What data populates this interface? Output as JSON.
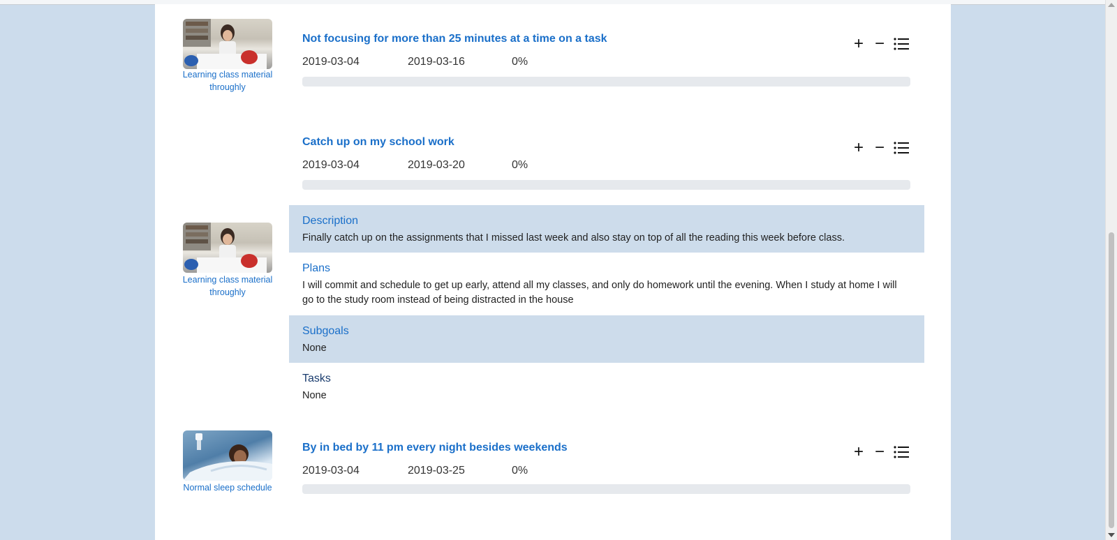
{
  "goals": [
    {
      "title": "Not focusing for more than 25 minutes at a time on a task",
      "start": "2019-03-04",
      "end": "2019-03-16",
      "progress": "0%",
      "progress_value": 0,
      "image_caption": "Learning class material throughly"
    },
    {
      "title": "Catch up on my school work",
      "start": "2019-03-04",
      "end": "2019-03-20",
      "progress": "0%",
      "progress_value": 0,
      "image_caption": "Learning class material throughly",
      "details": {
        "description_label": "Description",
        "description": "Finally catch up on the assignments that I missed last week and also stay on top of all the reading this week before class.",
        "plans_label": "Plans",
        "plans": "I will commit and schedule to get up early, attend all my classes, and only do homework until the evening. When I study at home I will go to the study room instead of being distracted in the house",
        "subgoals_label": "Subgoals",
        "subgoals": "None",
        "tasks_label": "Tasks",
        "tasks": "None"
      }
    },
    {
      "title": "By in bed by 11 pm every night besides weekends",
      "start": "2019-03-04",
      "end": "2019-03-25",
      "progress": "0%",
      "progress_value": 0,
      "image_caption": "Normal sleep schedule"
    }
  ],
  "icons": {
    "add": "plus-icon",
    "remove": "minus-icon",
    "list": "list-icon"
  },
  "colors": {
    "page_background": "#ccdcec",
    "accent": "#1a6fc9",
    "detail_shade": "#cddceb",
    "progress_track": "#e6e9ed"
  }
}
